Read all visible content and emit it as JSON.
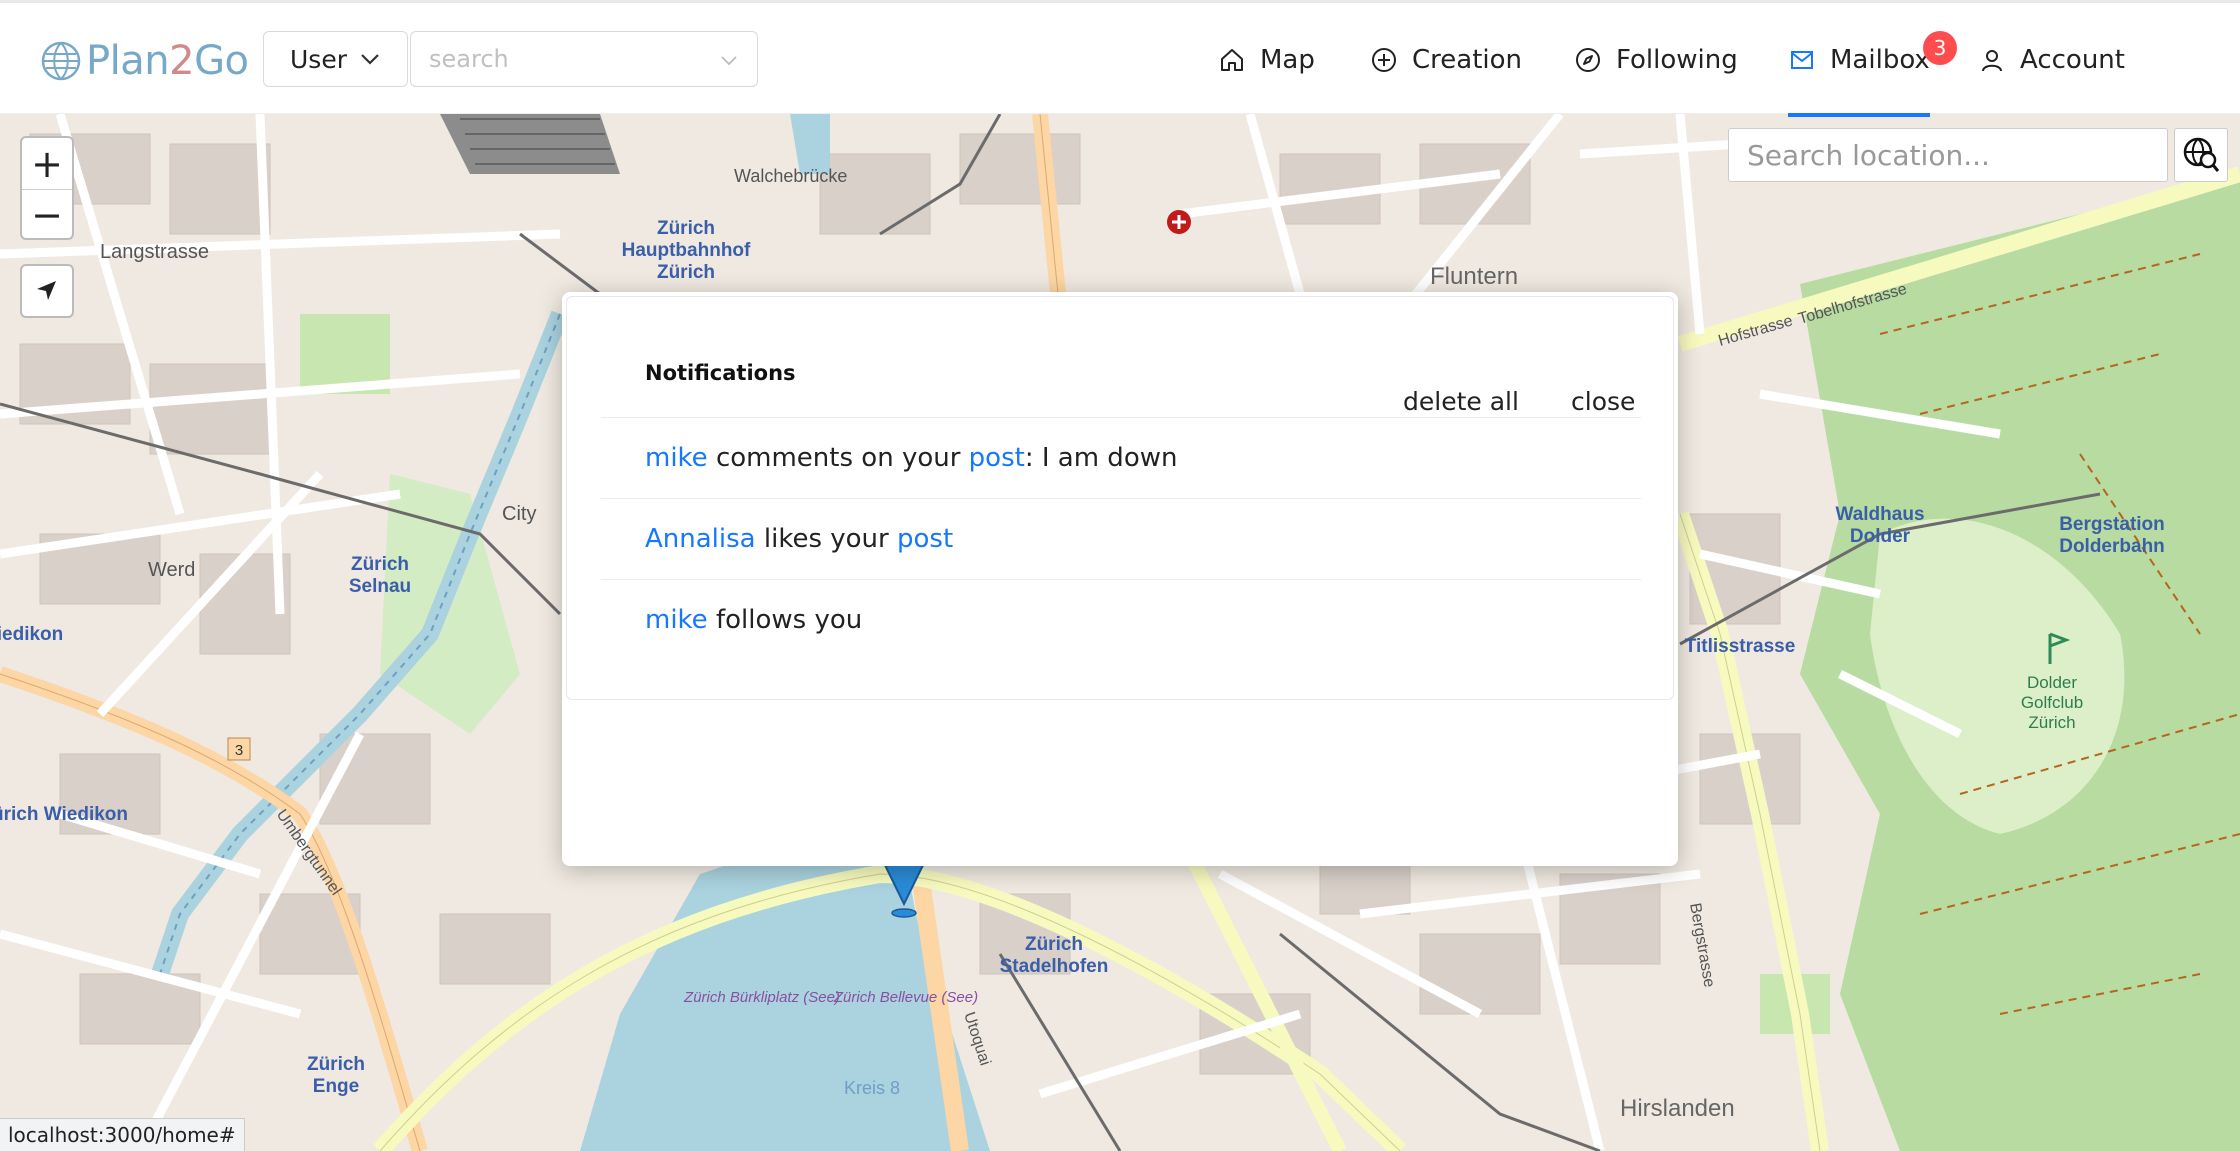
{
  "header": {
    "logo": {
      "plan": "Plan",
      "two": "2",
      "go": "Go"
    },
    "user_select": "User",
    "search_placeholder": "search",
    "nav": {
      "map": "Map",
      "creation": "Creation",
      "following": "Following",
      "mailbox": "Mailbox",
      "account": "Account"
    },
    "mailbox_badge": "3"
  },
  "map": {
    "zoom_in": "+",
    "zoom_out": "−",
    "location_placeholder": "Search location...",
    "labels": {
      "langstrasse": "Langstrasse",
      "walchebrucke": "Walchebrücke",
      "zurich_hb": "Zürich",
      "hauptbahnhof": "Hauptbahnhof",
      "zurich_hb2": "Zürich",
      "fluntern": "Fluntern",
      "city": "City",
      "werd": "Werd",
      "zurich_selnau": "Zürich",
      "selnau": "Selnau",
      "wiedikon": "iedikon",
      "zurich_wiedikon": "ürich Wiedikon",
      "waldhaus": "Waldhaus",
      "dolder": "Dolder",
      "bergstation": "Bergstation",
      "dolderbahn": "Dolderbahn",
      "titlisstrasse": "Titlisstrasse",
      "dolder_golf": "Dolder",
      "golfclub": "Golfclub",
      "zurich_golf": "Zürich",
      "stadelhofen_zurich": "Zürich",
      "stadelhofen": "Stadelhofen",
      "burkliplatz": "Zürich Bürkliplatz (See)",
      "bellevue": "Zürich Bellevue (See)",
      "enge_zurich": "Zürich",
      "enge": "Enge",
      "hirslanden": "Hirslanden",
      "kreis8": "Kreis 8",
      "utoquai": "Utoquai",
      "bergstrasse": "Bergstrasse",
      "tobelhofstrasse": "Tobelhofstrasse",
      "hofstrasse": "Hofstrasse",
      "umbergtunnel": "Umbergtunnel",
      "route3": "3"
    }
  },
  "notifications": {
    "title": "Notifications",
    "delete_all": "delete all",
    "close": "close",
    "items": [
      {
        "user": "mike",
        "text": " comments on your ",
        "link": "post",
        "suffix": ": I am down"
      },
      {
        "user": "Annalisa",
        "text": " likes your ",
        "link": "post",
        "suffix": ""
      },
      {
        "user": "mike",
        "text": " follows you",
        "link": "",
        "suffix": ""
      }
    ]
  },
  "status_url": "localhost:3000/home#",
  "colors": {
    "accent": "#1677ff",
    "badge": "#ff4d4f",
    "map_bg": "#efe9e1",
    "park": "#b7dba0",
    "water": "#aad3df",
    "road_yellow": "#f7fabf",
    "road_orange": "#fcd6a4"
  }
}
